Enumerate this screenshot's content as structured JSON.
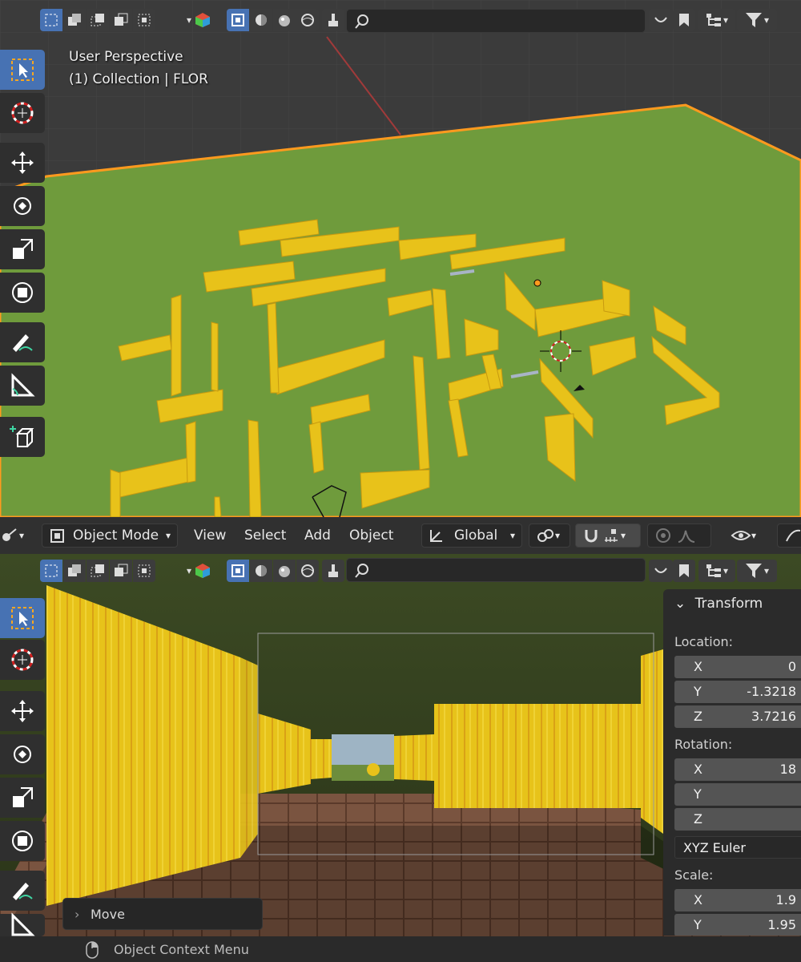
{
  "top_viewport": {
    "view_name": "User Perspective",
    "collection_info": "(1) Collection | FLOR"
  },
  "mode_bar": {
    "mode": "Object Mode",
    "menus": [
      "View",
      "Select",
      "Add",
      "Object"
    ],
    "transform_orientation": "Global"
  },
  "transform_panel": {
    "title": "Transform",
    "location_label": "Location:",
    "location": [
      {
        "axis": "X",
        "value": "0"
      },
      {
        "axis": "Y",
        "value": "-1.3218"
      },
      {
        "axis": "Z",
        "value": "3.7216"
      }
    ],
    "rotation_label": "Rotation:",
    "rotation": [
      {
        "axis": "X",
        "value": "18"
      },
      {
        "axis": "Y",
        "value": ""
      },
      {
        "axis": "Z",
        "value": ""
      }
    ],
    "rotation_mode": "XYZ Euler",
    "scale_label": "Scale:",
    "scale": [
      {
        "axis": "X",
        "value": "1.9"
      },
      {
        "axis": "Y",
        "value": "1.95"
      }
    ]
  },
  "operator_panel": {
    "label": "Move"
  },
  "status_bar": {
    "hint": "Object Context Menu"
  },
  "icons": [
    "select-box-icon",
    "cursor-icon",
    "move-icon",
    "rotate-icon",
    "scale-icon",
    "transform-icon",
    "annotate-icon",
    "measure-icon",
    "add-cube-icon",
    "search-icon",
    "filter-icon"
  ],
  "colors": {
    "accent": "#4772b3",
    "grass": "#6f9b3c",
    "wall": "#e8c21a",
    "selection_outline": "#ff9a1e"
  }
}
